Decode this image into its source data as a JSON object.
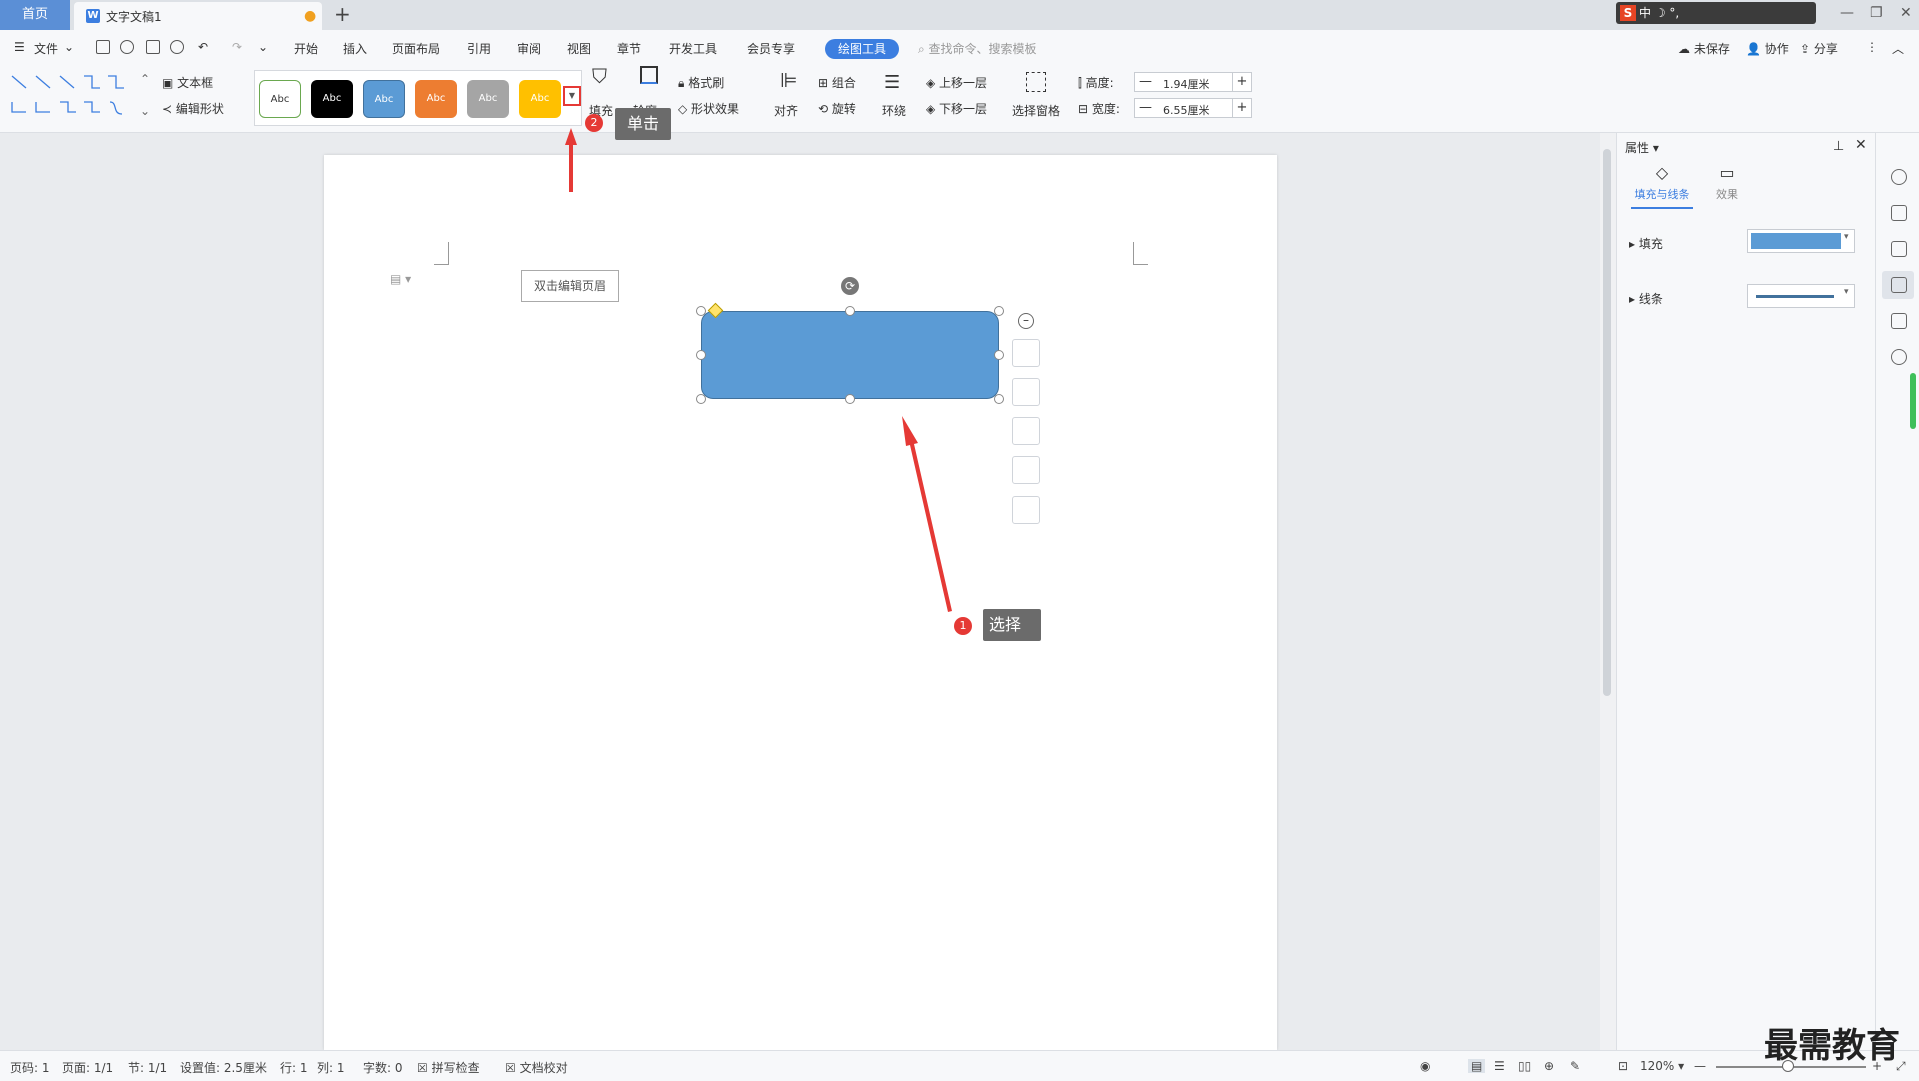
{
  "titlebar": {
    "home_tab": "首页",
    "doc_tab": "文字文稿1",
    "doc_logo": "W",
    "unsaved_dot": "●",
    "add_tab": "+",
    "ime_chars": "中 ☽ °,",
    "win_min": "—",
    "win_max": "❐",
    "win_close": "✕"
  },
  "menu": {
    "file": "文件",
    "items": [
      "开始",
      "插入",
      "页面布局",
      "引用",
      "审阅",
      "视图",
      "章节",
      "开发工具",
      "会员专享"
    ],
    "active": "绘图工具",
    "search_placeholder": "查找命令、搜索模板",
    "unsaved": "未保存",
    "collab": "协作",
    "share": "分享"
  },
  "ribbon": {
    "textbox": "文本框",
    "edit_shape": "编辑形状",
    "style_label": "Abc",
    "fill": "填充",
    "outline": "轮廓",
    "format_brush": "格式刷",
    "shape_effect": "形状效果",
    "align": "对齐",
    "group": "组合",
    "rotate": "旋转",
    "wrap": "环绕",
    "bring_forward": "上移一层",
    "send_backward": "下移一层",
    "select_pane": "选择窗格",
    "height_label": "高度:",
    "height_value": "1.94厘米",
    "width_label": "宽度:",
    "width_value": "6.55厘米",
    "minus": "—",
    "plus": "+"
  },
  "document": {
    "header_hint": "双击编辑页眉"
  },
  "annotations": {
    "step1_num": "1",
    "step1_text": "选择",
    "step2_num": "2",
    "step2_text": "单击"
  },
  "panel": {
    "title": "属性",
    "tab_fill_line": "填充与线条",
    "tab_effect": "效果",
    "fill": "填充",
    "line": "线条",
    "fill_color": "#5b9bd5"
  },
  "status": {
    "page_no": "页码: 1",
    "pages": "页面: 1/1",
    "section": "节: 1/1",
    "setting": "设置值: 2.5厘米",
    "row": "行: 1",
    "col": "列: 1",
    "words": "字数: 0",
    "spell": "拼写检查",
    "proof": "文档校对",
    "zoom": "120%",
    "zoom_minus": "—",
    "zoom_plus": "+"
  },
  "watermark": "最需教育",
  "colors": {
    "accent": "#3c7ee0",
    "shape_fill": "#5b9bd5",
    "annotation_red": "#e53935"
  }
}
